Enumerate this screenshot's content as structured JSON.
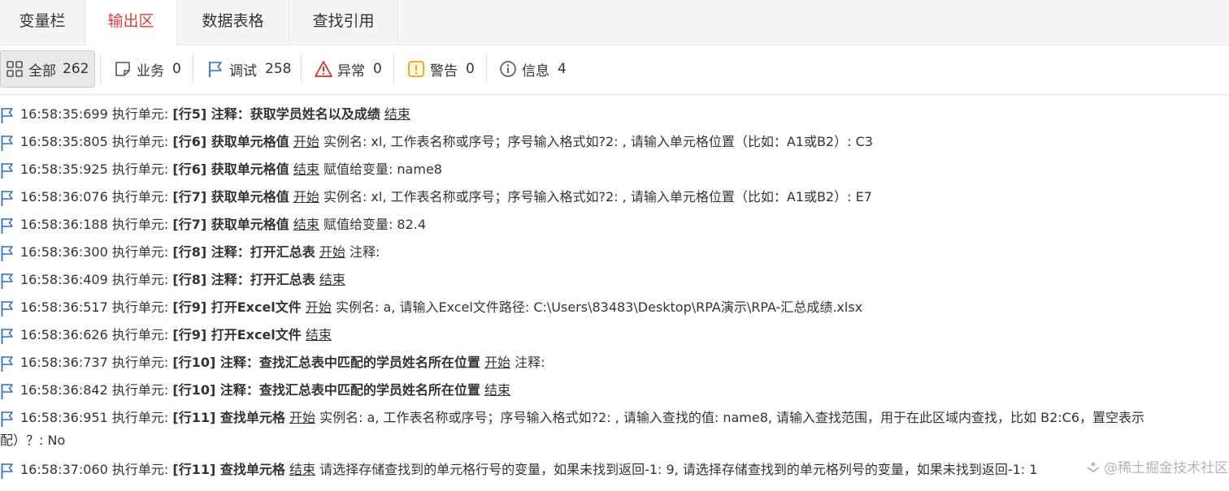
{
  "tabs": [
    {
      "label": "变量栏",
      "active": false
    },
    {
      "label": "输出区",
      "active": true
    },
    {
      "label": "数据表格",
      "active": false
    },
    {
      "label": "查找引用",
      "active": false
    }
  ],
  "filters": [
    {
      "icon": "grid-icon",
      "label": "全部",
      "count": "262",
      "active": true
    },
    {
      "icon": "note-icon",
      "label": "业务",
      "count": "0",
      "active": false
    },
    {
      "icon": "flag-icon",
      "label": "调试",
      "count": "258",
      "active": false
    },
    {
      "icon": "error-triangle-icon",
      "label": "异常",
      "count": "0",
      "active": false
    },
    {
      "icon": "warning-icon",
      "label": "警告",
      "count": "0",
      "active": false
    },
    {
      "icon": "info-icon",
      "label": "信息",
      "count": "4",
      "active": false
    }
  ],
  "colors": {
    "active_tab": "#e23b3b",
    "flag": "#2d6fd1",
    "error": "#e02a2a",
    "warning": "#f0a500"
  },
  "log": [
    {
      "time": "16:58:35:699",
      "prefix": "执行单元:",
      "step": "[行5] 注释：获取学员姓名以及成绩",
      "phase": "结束",
      "detail": ""
    },
    {
      "time": "16:58:35:805",
      "prefix": "执行单元:",
      "step": "[行6] 获取单元格值",
      "phase": "开始",
      "detail": "实例名: xl, 工作表名称或序号；序号输入格式如?2: , 请输入单元格位置（比如：A1或B2）: C3"
    },
    {
      "time": "16:58:35:925",
      "prefix": "执行单元:",
      "step": "[行6] 获取单元格值",
      "phase": "结束",
      "detail": "赋值给变量: name8"
    },
    {
      "time": "16:58:36:076",
      "prefix": "执行单元:",
      "step": "[行7] 获取单元格值",
      "phase": "开始",
      "detail": "实例名: xl, 工作表名称或序号；序号输入格式如?2: , 请输入单元格位置（比如：A1或B2）: E7"
    },
    {
      "time": "16:58:36:188",
      "prefix": "执行单元:",
      "step": "[行7] 获取单元格值",
      "phase": "结束",
      "detail": "赋值给变量: 82.4"
    },
    {
      "time": "16:58:36:300",
      "prefix": "执行单元:",
      "step": "[行8] 注释：打开汇总表",
      "phase": "开始",
      "detail": "注释:"
    },
    {
      "time": "16:58:36:409",
      "prefix": "执行单元:",
      "step": "[行8] 注释：打开汇总表",
      "phase": "结束",
      "detail": ""
    },
    {
      "time": "16:58:36:517",
      "prefix": "执行单元:",
      "step": "[行9] 打开Excel文件",
      "phase": "开始",
      "detail": "实例名: a, 请输入Excel文件路径: C:\\Users\\83483\\Desktop\\RPA演示\\RPA-汇总成绩.xlsx"
    },
    {
      "time": "16:58:36:626",
      "prefix": "执行单元:",
      "step": "[行9] 打开Excel文件",
      "phase": "结束",
      "detail": ""
    },
    {
      "time": "16:58:36:737",
      "prefix": "执行单元:",
      "step": "[行10] 注释：查找汇总表中匹配的学员姓名所在位置",
      "phase": "开始",
      "detail": "注释:"
    },
    {
      "time": "16:58:36:842",
      "prefix": "执行单元:",
      "step": "[行10] 注释：查找汇总表中匹配的学员姓名所在位置",
      "phase": "结束",
      "detail": ""
    },
    {
      "time": "16:58:36:951",
      "prefix": "执行单元:",
      "step": "[行11] 查找单元格",
      "phase": "开始",
      "detail": "实例名: a, 工作表名称或序号；序号输入格式如?2: , 请输入查找的值: name8, 请输入查找范围，用于在此区域内查找，比如 B2:C6，置空表示"
    },
    {
      "continuation": "配）？: No"
    },
    {
      "time": "16:58:37:060",
      "prefix": "执行单元:",
      "step": "[行11] 查找单元格",
      "phase": "结束",
      "detail": "请选择存储查找到的单元格行号的变量，如果未找到返回-1: 9, 请选择存储查找到的单元格列号的变量，如果未找到返回-1: 1"
    }
  ],
  "watermark": "@稀土掘金技术社区"
}
